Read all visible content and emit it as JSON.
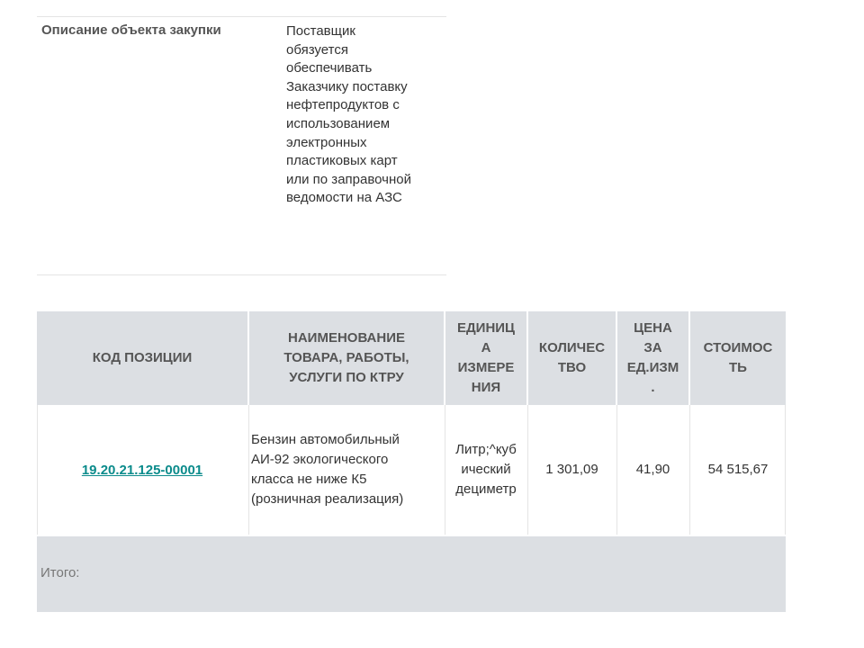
{
  "description": {
    "label": "Описание объекта закупки",
    "value": "Поставщик\nобязуется\nобеспечивать\nЗаказчику поставку\nнефтепродуктов с\nиспользованием\nэлектронных\nпластиковых карт\nили по заправочной\nведомости на АЗС"
  },
  "positions": {
    "headers": {
      "code": "КОД ПОЗИЦИИ",
      "name": "НАИМЕНОВАНИЕ\nТОВАРА, РАБОТЫ,\nУСЛУГИ ПО КТРУ",
      "unit": "ЕДИНИЦ\nА\nИЗМЕРЕ\nНИЯ",
      "quantity": "КОЛИЧЕС\nТВО",
      "price": "ЦЕНА\nЗА\nЕД.ИЗМ\n.",
      "cost": "СТОИМОС\nТЬ"
    },
    "rows": [
      {
        "code": "19.20.21.125-00001",
        "name": "Бензин автомобильный\nАИ-92 экологического\nкласса не ниже К5\n(розничная реализация)",
        "unit": "Литр;^куб\nический\nдециметр",
        "quantity": "1 301,09",
        "price": "41,90",
        "cost": "54 515,67"
      }
    ],
    "total_label": "Итого:"
  },
  "colors": {
    "header_bg": "#dcdfe3",
    "link": "#0b8b8b"
  }
}
